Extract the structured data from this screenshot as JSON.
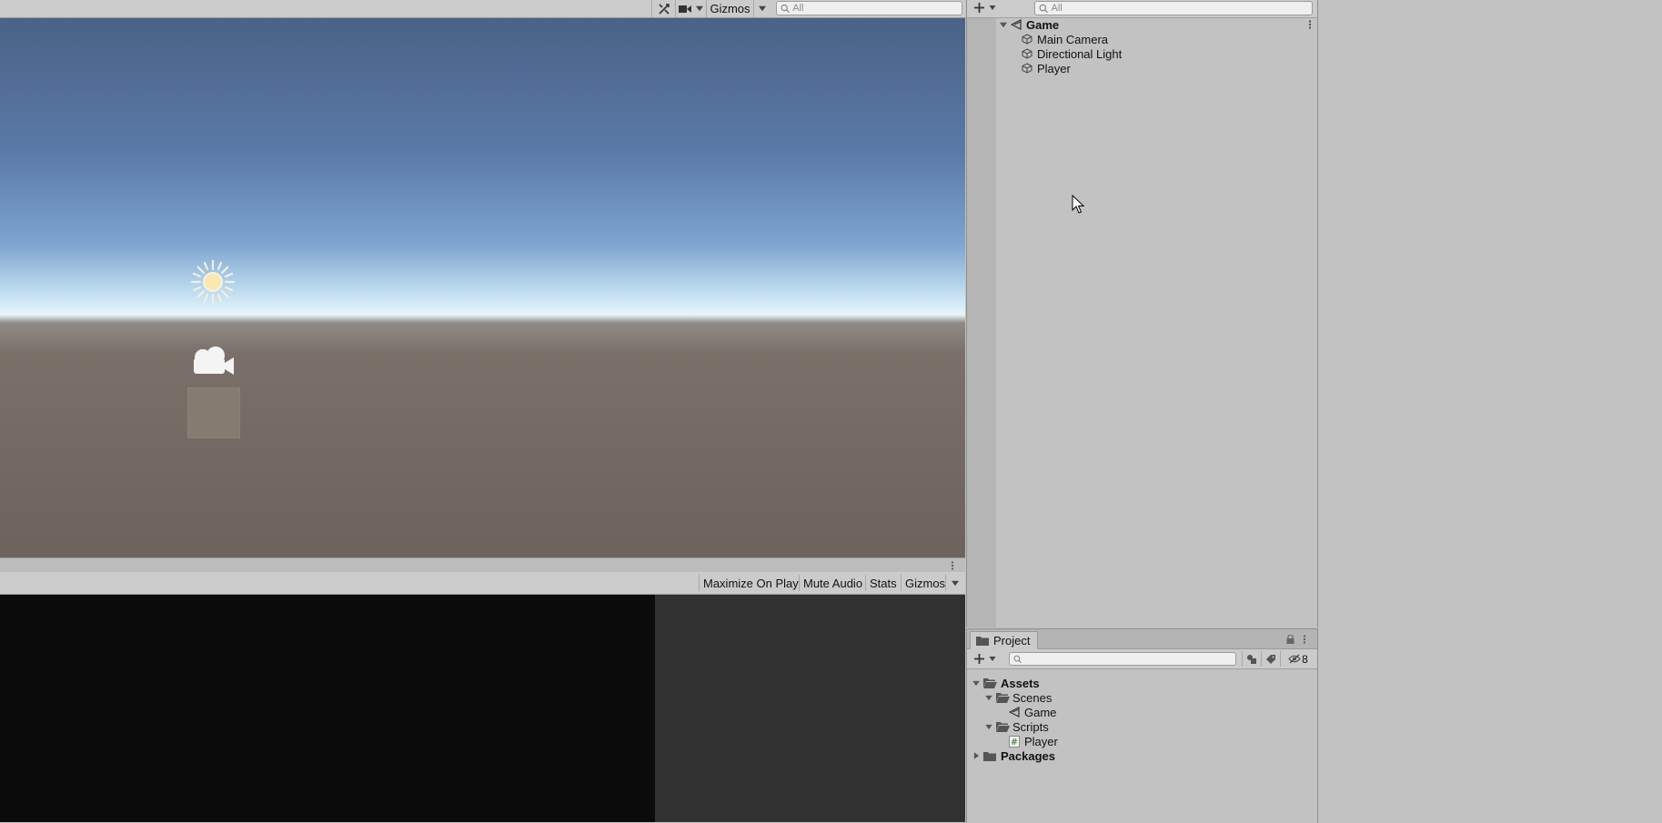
{
  "scene_view": {
    "toolbar": {
      "gizmos_label": "Gizmos",
      "search_placeholder": "All"
    }
  },
  "game_view": {
    "toolbar": {
      "maximize_label": "Maximize On Play",
      "mute_label": "Mute Audio",
      "stats_label": "Stats",
      "gizmos_label": "Gizmos"
    }
  },
  "hierarchy": {
    "search_placeholder": "All",
    "scene_name": "Game",
    "items": [
      {
        "label": "Main Camera"
      },
      {
        "label": "Directional Light"
      },
      {
        "label": "Player"
      }
    ]
  },
  "project": {
    "tab_label": "Project",
    "search_placeholder": "",
    "hidden_count": "8",
    "tree": {
      "assets": "Assets",
      "scenes": "Scenes",
      "scene_game": "Game",
      "scripts": "Scripts",
      "script_player": "Player",
      "packages": "Packages"
    }
  },
  "colors": {
    "panel_bg": "#c2c2c2",
    "toolbar_bg": "#cbcbcb",
    "game_left_bg": "#0b0b0b",
    "game_right_bg": "#313131"
  },
  "icons": [
    "tools-icon",
    "camera-icon",
    "chevron-down-icon",
    "search-icon",
    "plus-icon",
    "scene-icon",
    "gameobject-cube-icon",
    "kebab-menu-icon",
    "lock-icon",
    "folder-icon",
    "script-icon",
    "sun-gizmo-icon",
    "camera-gizmo-icon"
  ]
}
